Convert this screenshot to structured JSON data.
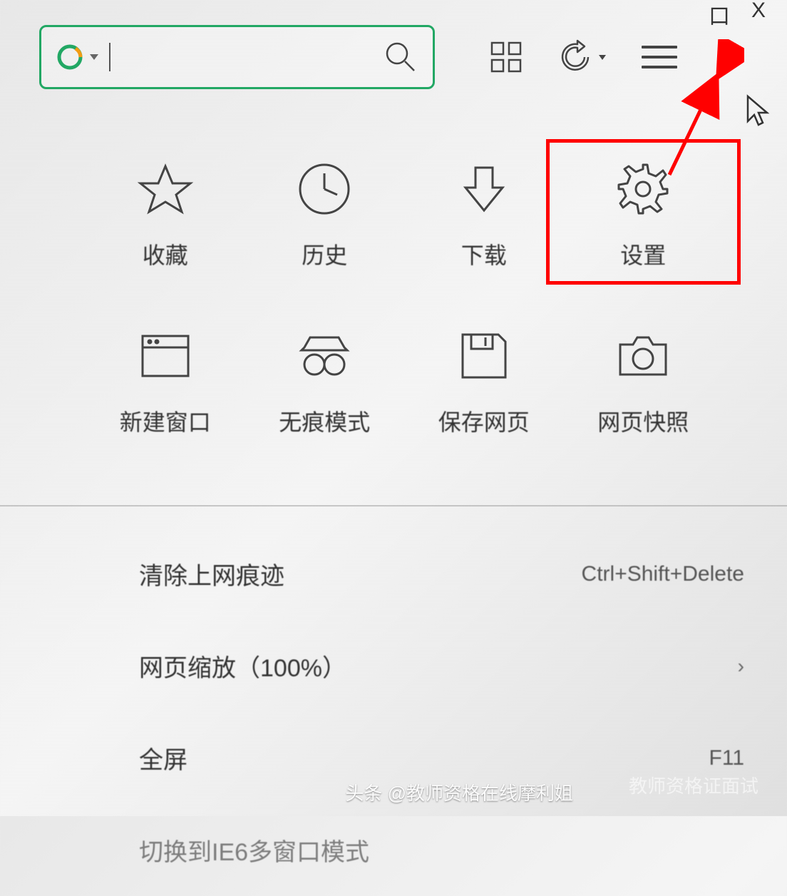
{
  "window_controls": {
    "maximize": "口",
    "close": "X"
  },
  "search": {
    "placeholder": "",
    "value": ""
  },
  "toolbar": {
    "grid_icon": "grid",
    "undo_icon": "undo",
    "menu_icon": "hamburger"
  },
  "menu_grid": [
    {
      "label": "收藏",
      "icon": "star"
    },
    {
      "label": "历史",
      "icon": "clock"
    },
    {
      "label": "下载",
      "icon": "download"
    },
    {
      "label": "设置",
      "icon": "gear",
      "highlighted": true
    },
    {
      "label": "新建窗口",
      "icon": "window"
    },
    {
      "label": "无痕模式",
      "icon": "incognito"
    },
    {
      "label": "保存网页",
      "icon": "save"
    },
    {
      "label": "网页快照",
      "icon": "camera"
    }
  ],
  "menu_list": [
    {
      "label": "清除上网痕迹",
      "shortcut": "Ctrl+Shift+Delete"
    },
    {
      "label": "网页缩放（100%）",
      "shortcut": "›"
    },
    {
      "label": "全屏",
      "shortcut": "F11"
    },
    {
      "label": "切换到IE6多窗口模式",
      "shortcut": ""
    }
  ],
  "watermark": "头条 @教师资格在线摩利姐",
  "watermark2": "教师资格证面试"
}
